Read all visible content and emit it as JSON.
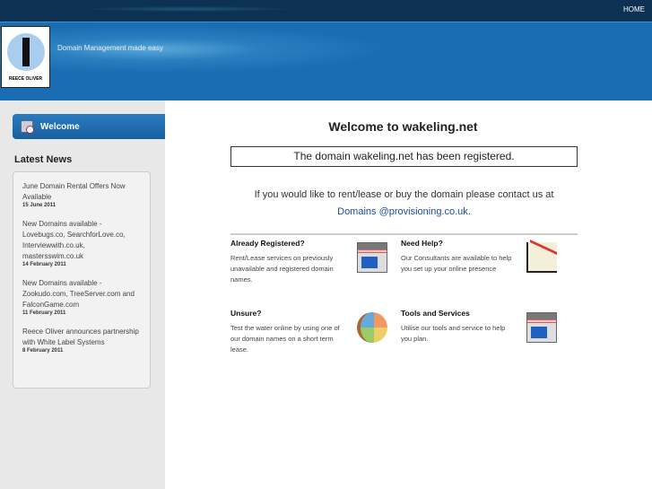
{
  "nav": {
    "home": "HOME"
  },
  "header": {
    "logo_text": "REECE OLIVER",
    "tagline": "Domain Management made easy"
  },
  "sidebar": {
    "welcome": "Welcome",
    "news_title": "Latest News",
    "news": [
      {
        "title": "June Domain Rental Offers Now Available",
        "date": "15 June 2011"
      },
      {
        "title": "New Domains available - Lovebugs.co, SearchforLove.co, Interviewwith.co.uk, mastersswim.co.uk",
        "date": "14 February 2011"
      },
      {
        "title": "New Domains available - Zookudo.com, TreeServer.com and FalconGame.com",
        "date": "11 February 2011"
      },
      {
        "title": "Reece Oliver announces partnership with White Label Systems",
        "date": "8 February 2011"
      }
    ]
  },
  "main": {
    "title": "Welcome to wakeling.net",
    "registered": "The domain wakeling.net has been registered.",
    "contact_text": "If you would like to rent/lease or buy the domain please contact us at",
    "contact_link": "Domains @provisioning.co.uk",
    "contact_end": ".",
    "features": [
      {
        "title": "Already Registered?",
        "text": "Rent/Lease services on previously unavailable and registered domain names.",
        "icon": "shop-icon"
      },
      {
        "title": "Need Help?",
        "text": "Our Consultants are available to help you set up your online presence",
        "icon": "chart-icon"
      },
      {
        "title": "Unsure?",
        "text": "Test the water online by using one of our domain names on a short term lease.",
        "icon": "palette-icon"
      },
      {
        "title": "Tools and Services",
        "text": "Utilise our tools and service to help you plan.",
        "icon": "shop-icon"
      }
    ]
  }
}
